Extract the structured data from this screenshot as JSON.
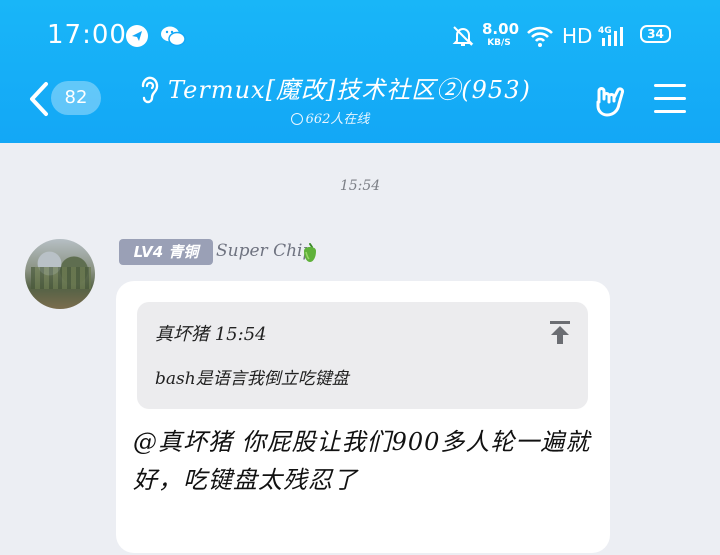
{
  "status_bar": {
    "time": "17:00",
    "net_speed": "8.00",
    "net_unit": "KB/S",
    "hd": "HD",
    "battery": "34"
  },
  "header": {
    "unread_count": "82",
    "group_title": "Termux[魔改]技术社区②(953)",
    "online_text": "662人在线"
  },
  "chat": {
    "timestamp": "15:54",
    "sender": {
      "level": "LV4 青铜",
      "nickname": "Super Chip"
    },
    "quote": {
      "header": "真坏猪 15:54",
      "text": "bash是语言我倒立吃键盘"
    },
    "message": "@真坏猪 你屁股让我们900多人轮一遍就好，吃键盘太残忍了"
  },
  "colors": {
    "header_bg": "#13a7f6",
    "chat_bg": "#eceef3",
    "level_badge": "#9aa0b6"
  }
}
